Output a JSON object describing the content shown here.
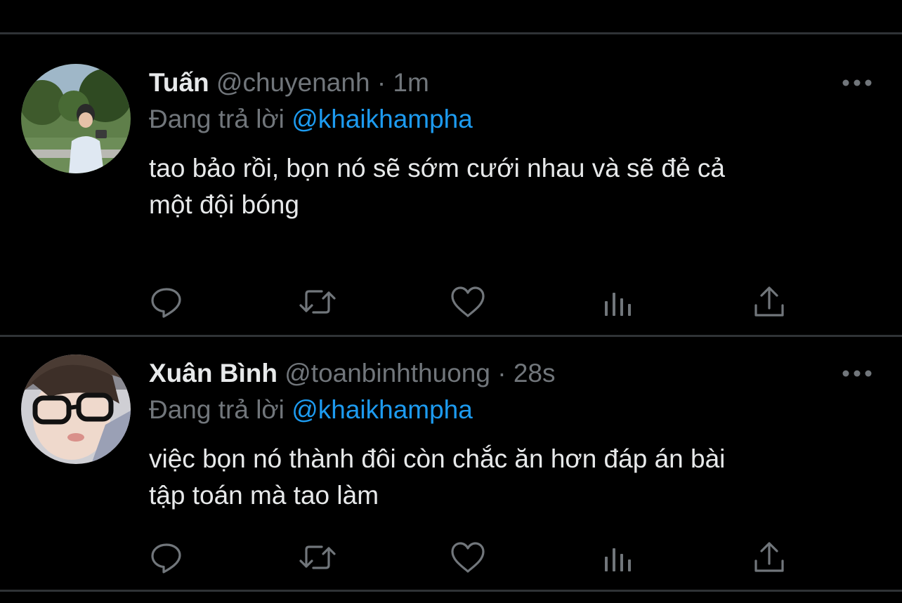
{
  "tweets": [
    {
      "display_name": "Tuấn",
      "handle": "@chuyenanh",
      "separator": "·",
      "time": "1m",
      "reply_prefix": "Đang trả lời",
      "reply_mention": "@khaikhampha",
      "text_line1": "tao bảo rồi, bọn nó sẽ sớm cưới nhau và sẽ đẻ cả",
      "text_line2": "một đội bóng"
    },
    {
      "display_name": "Xuân Bình",
      "handle": "@toanbinhthuong",
      "separator": "·",
      "time": "28s",
      "reply_prefix": "Đang trả lời",
      "reply_mention": "@khaikhampha",
      "text_line1": "việc bọn nó thành đôi còn chắc ăn hơn đáp án bài",
      "text_line2": "tập toán mà tao làm"
    }
  ],
  "action_icons": [
    "reply-icon",
    "retweet-icon",
    "like-icon",
    "analytics-icon",
    "share-icon"
  ],
  "colors": {
    "background": "#000000",
    "text": "#e7e9ea",
    "secondary": "#71767b",
    "accent": "#1d9bf0",
    "divider": "#2f3336"
  }
}
